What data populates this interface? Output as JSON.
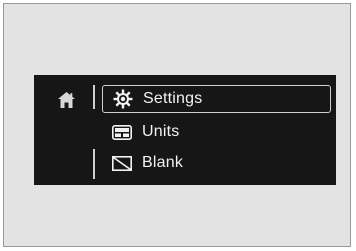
{
  "menu": {
    "home_icon": "home-icon",
    "items": [
      {
        "label": "Settings",
        "icon": "gear-icon",
        "selected": true
      },
      {
        "label": "Units",
        "icon": "units-icon",
        "selected": false
      },
      {
        "label": "Blank",
        "icon": "blank-screen-icon",
        "selected": false
      }
    ]
  },
  "colors": {
    "screen_background": "#161616",
    "text": "#f2f2f2",
    "highlight_border": "#cfcfcf"
  }
}
